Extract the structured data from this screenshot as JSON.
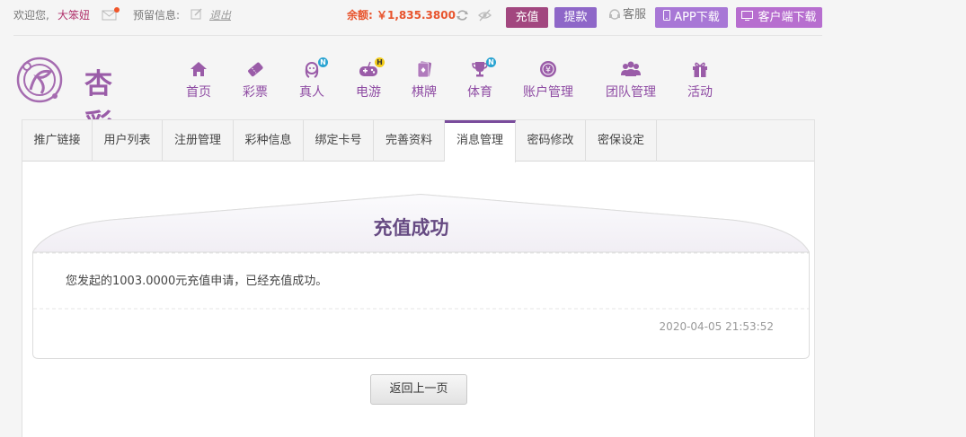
{
  "topbar": {
    "welcome": "欢迎您,",
    "username": "大笨妞",
    "notice_label": "预留信息:",
    "logout": "退出",
    "balance_label": "余额:",
    "balance_value": "￥1,835.3800",
    "recharge": "充值",
    "withdraw": "提款",
    "service": "客服",
    "app_download": "APP下载",
    "client_download": "客户端下载"
  },
  "logo": {
    "text": "杏彩"
  },
  "nav": {
    "items": [
      {
        "label": "首页",
        "icon": "home-icon"
      },
      {
        "label": "彩票",
        "icon": "lottery-ticket-icon"
      },
      {
        "label": "真人",
        "icon": "live-dealer-icon",
        "badge": "N"
      },
      {
        "label": "电游",
        "icon": "gamepad-icon",
        "badge": "H"
      },
      {
        "label": "棋牌",
        "icon": "cards-icon"
      },
      {
        "label": "体育",
        "icon": "trophy-icon",
        "badge": "N"
      },
      {
        "label": "账户管理",
        "icon": "account-coin-icon"
      },
      {
        "label": "团队管理",
        "icon": "team-icon"
      },
      {
        "label": "活动",
        "icon": "gift-icon"
      }
    ]
  },
  "tabs": [
    {
      "label": "推广链接"
    },
    {
      "label": "用户列表"
    },
    {
      "label": "注册管理"
    },
    {
      "label": "彩种信息"
    },
    {
      "label": "绑定卡号"
    },
    {
      "label": "完善资料"
    },
    {
      "label": "消息管理",
      "active": true
    },
    {
      "label": "密码修改"
    },
    {
      "label": "密保设定"
    }
  ],
  "message": {
    "title": "充值成功",
    "body": "您发起的1003.0000元充值申请，已经充值成功。",
    "time": "2020-04-05 21:53:52"
  },
  "back_button": "返回上一页",
  "colors": {
    "brand_purple": "#8e4ba3",
    "balance_orange": "#e8542d",
    "recharge_btn": "#a2477f",
    "withdraw_btn": "#8e67c8"
  }
}
